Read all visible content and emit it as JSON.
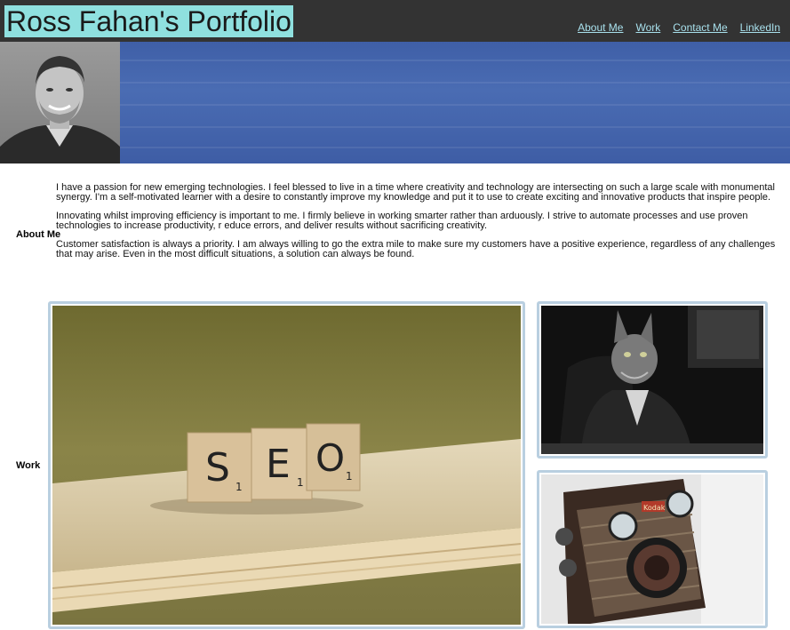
{
  "header": {
    "title": "Ross Fahan's Portfolio",
    "nav": [
      "About Me",
      "Work",
      "Contact Me",
      "LinkedIn"
    ]
  },
  "about": {
    "label": "About Me",
    "paragraphs": [
      "I have a passion for new emerging technologies. I feel blessed to live in a time where creativity and technology are intersecting on such a large scale with monumental synergy. I'm a self-motivated learner with a desire to constantly improve my knowledge and put it to use to create exciting and innovative products that inspire people.",
      "Innovating whilst improving efficiency is important to me. I firmly believe in working smarter rather than arduously. I strive to automate processes and use proven technologies to increase productivity, r educe errors, and deliver results without sacrificing creativity.",
      "Customer satisfaction is always a priority. I am always willing to go the extra mile to make sure my customers have a positive experience, regardless of any challenges that may arise. Even in the most difficult situations, a solution can always be found."
    ]
  },
  "work": {
    "label": "Work",
    "tiles": [
      {
        "tiles_letters": [
          "S",
          "E",
          "O"
        ],
        "subscripts": [
          "1",
          "1",
          "1"
        ]
      },
      {},
      {
        "camera_badge": "Kodak"
      }
    ]
  }
}
